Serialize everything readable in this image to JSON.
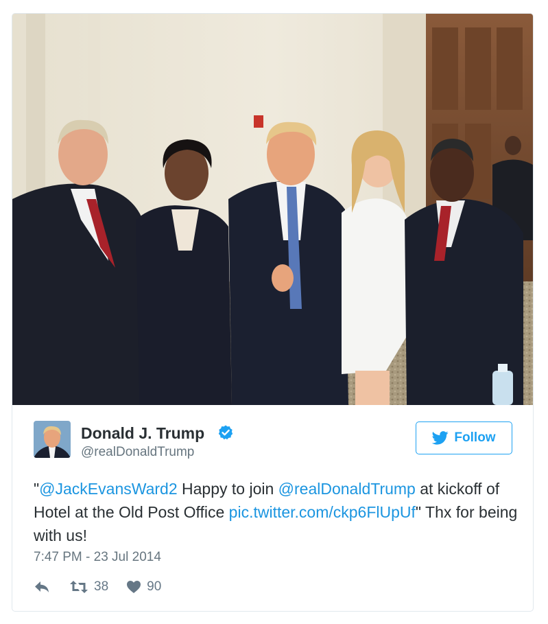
{
  "photo": {
    "subject": "group-photo"
  },
  "user": {
    "display_name": "Donald J. Trump",
    "handle": "@realDonaldTrump",
    "verified": true
  },
  "follow": {
    "label": "Follow"
  },
  "tweet": {
    "open_quote": "\"",
    "mention_1": "@JackEvansWard2",
    "text_1": " Happy to join ",
    "mention_2": "@realDonaldTrump",
    "text_2": " at kickoff of Hotel at the Old Post Office ",
    "link": "pic.twitter.com/ckp6FlUpUf",
    "text_3": "\" Thx for being with us!"
  },
  "timestamp": "7:47 PM - 23 Jul 2014",
  "actions": {
    "retweet_count": "38",
    "like_count": "90"
  },
  "colors": {
    "link": "#1b95e0",
    "follow": "#1da1f2",
    "muted": "#66757f",
    "border": "#e1e8ed"
  }
}
